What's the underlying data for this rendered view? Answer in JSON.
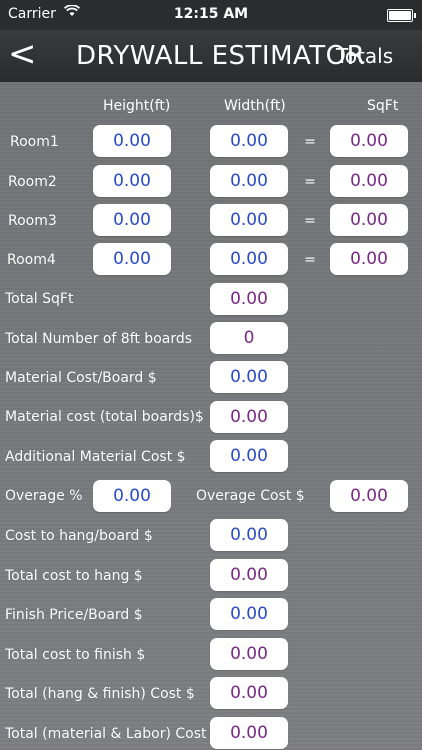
{
  "status": {
    "carrier": "Carrier",
    "time": "12:15 AM",
    "wifi_icon": "wifi-icon",
    "battery_icon": "battery-icon"
  },
  "nav": {
    "back": "<",
    "title": "DRYWALL ESTIMATOR",
    "action": "Totals"
  },
  "headers": {
    "height": "Height(ft)",
    "width": "Width(ft)",
    "sqft": "SqFt"
  },
  "rooms": [
    {
      "label": "Room1",
      "height": "0.00",
      "width": "0.00",
      "eq": "=",
      "sqft": "0.00"
    },
    {
      "label": "Room2",
      "height": "0.00",
      "width": "0.00",
      "eq": "=",
      "sqft": "0.00"
    },
    {
      "label": "Room3",
      "height": "0.00",
      "width": "0.00",
      "eq": "=",
      "sqft": "0.00"
    },
    {
      "label": "Room4",
      "height": "0.00",
      "width": "0.00",
      "eq": "=",
      "sqft": "0.00"
    }
  ],
  "fields": {
    "total_sqft": {
      "label": "Total SqFt",
      "value": "0.00"
    },
    "boards": {
      "label": "Total Number of 8ft boards",
      "value": "0"
    },
    "material_cost_board": {
      "label": "Material Cost/Board $",
      "value": "0.00"
    },
    "material_cost_total": {
      "label": "Material cost (total boards)$",
      "value": "0.00"
    },
    "additional_material": {
      "label": "Additional Material Cost $",
      "value": "0.00"
    },
    "overage_pct": {
      "label": "Overage %",
      "value": "0.00"
    },
    "overage_cost": {
      "label": "Overage Cost $",
      "value": "0.00"
    },
    "hang_board": {
      "label": "Cost to hang/board $",
      "value": "0.00"
    },
    "total_hang": {
      "label": "Total cost to hang $",
      "value": "0.00"
    },
    "finish_board": {
      "label": "Finish Price/Board $",
      "value": "0.00"
    },
    "total_finish": {
      "label": "Total cost to finish $",
      "value": "0.00"
    },
    "total_hang_finish": {
      "label": "Total (hang & finish) Cost $",
      "value": "0.00"
    },
    "total_material_labor": {
      "label": "Total (material & Labor) Cost",
      "value": "0.00"
    }
  },
  "colors": {
    "input_text": "#2a4bc9",
    "output_text": "#7a2a86",
    "nav_bg": "#2d2e30"
  }
}
